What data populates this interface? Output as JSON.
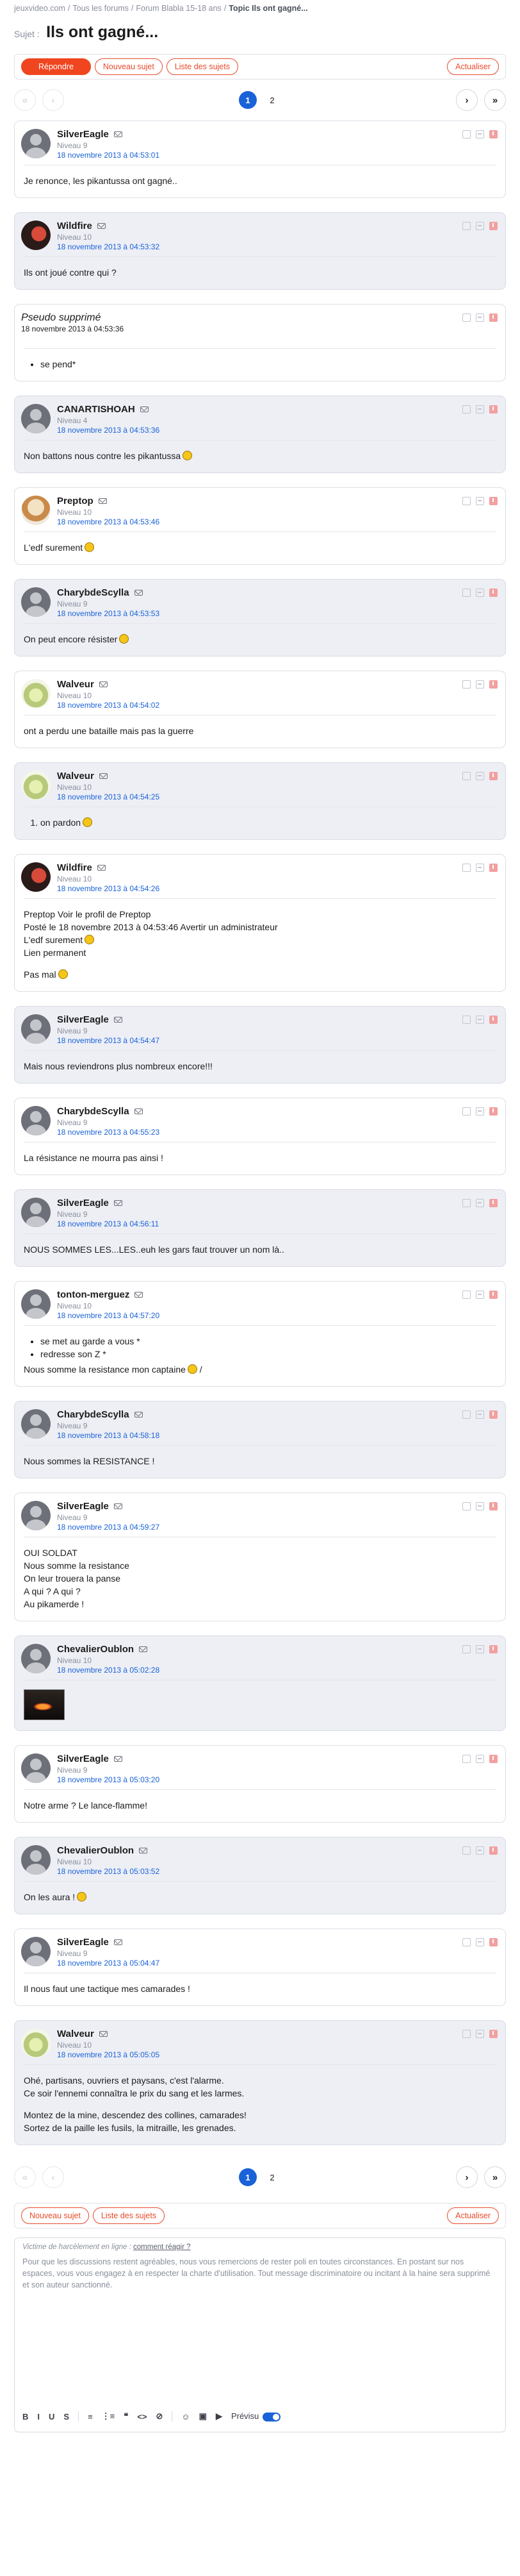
{
  "breadcrumb": [
    "jeuxvideo.com",
    "Tous les forums",
    "Forum Blabla 15-18 ans",
    "Topic Ils ont gagné..."
  ],
  "subject": {
    "label": "Sujet :",
    "title": "Ils ont gagné..."
  },
  "toolbar": {
    "reply": "Répondre",
    "new_topic": "Nouveau sujet",
    "list": "Liste des sujets",
    "refresh": "Actualiser"
  },
  "pagination": {
    "pages": [
      "1",
      "2"
    ],
    "current": "1",
    "first": "«",
    "prev": "‹",
    "next": "›",
    "last": "»"
  },
  "posts": [
    {
      "author": "SilverEagle",
      "level": "Niveau 9",
      "date": "18 novembre 2013 à 04:53:01",
      "avatar": "default",
      "lines": [
        "Je renonce, les pikantussa ont gagné.."
      ]
    },
    {
      "author": "Wildfire",
      "level": "Niveau 10",
      "date": "18 novembre 2013 à 04:53:32",
      "avatar": "wildfire",
      "lines": [
        "Ils ont joué contre qui ?"
      ]
    },
    {
      "author": "Pseudo supprimé",
      "level": "",
      "date": "18 novembre 2013 à 04:53:36",
      "avatar": "none",
      "bullets": [
        "se pend*"
      ]
    },
    {
      "author": "CANARTISHOAH",
      "level": "Niveau 4",
      "date": "18 novembre 2013 à 04:53:36",
      "avatar": "default",
      "lines": [
        "Non battons nous contre les pikantussa"
      ],
      "smiley": true
    },
    {
      "author": "Preptop",
      "level": "Niveau 10",
      "date": "18 novembre 2013 à 04:53:46",
      "avatar": "preptop",
      "lines": [
        "L'edf surement"
      ],
      "smiley": true
    },
    {
      "author": "CharybdeScylla",
      "level": "Niveau 9",
      "date": "18 novembre 2013 à 04:53:53",
      "avatar": "default",
      "lines": [
        "On peut encore résister"
      ],
      "smiley": true
    },
    {
      "author": "Walveur",
      "level": "Niveau 10",
      "date": "18 novembre 2013 à 04:54:02",
      "avatar": "walveur",
      "lines": [
        "ont a perdu une bataille mais pas la guerre"
      ]
    },
    {
      "author": "Walveur",
      "level": "Niveau 10",
      "date": "18 novembre 2013 à 04:54:25",
      "avatar": "walveur",
      "ordered": [
        "on pardon"
      ],
      "smiley": true
    },
    {
      "author": "Wildfire",
      "level": "Niveau 10",
      "date": "18 novembre 2013 à 04:54:26",
      "avatar": "wildfire",
      "lines": [
        "Preptop Voir le profil de Preptop",
        "Posté le 18 novembre 2013 à 04:53:46 Avertir un administrateur",
        "L'edf surement",
        "Lien permanent",
        "",
        "Pas mal"
      ]
    },
    {
      "author": "SilverEagle",
      "level": "Niveau 9",
      "date": "18 novembre 2013 à 04:54:47",
      "avatar": "default",
      "lines": [
        "Mais nous reviendrons plus nombreux encore!!!"
      ]
    },
    {
      "author": "CharybdeScylla",
      "level": "Niveau 9",
      "date": "18 novembre 2013 à 04:55:23",
      "avatar": "default",
      "lines": [
        "La résistance ne mourra pas ainsi !"
      ]
    },
    {
      "author": "SilverEagle",
      "level": "Niveau 9",
      "date": "18 novembre 2013 à 04:56:11",
      "avatar": "default",
      "lines": [
        "NOUS SOMMES LES...LES..euh les gars faut trouver un nom là.."
      ]
    },
    {
      "author": "tonton-merguez",
      "level": "Niveau 10",
      "date": "18 novembre 2013 à 04:57:20",
      "avatar": "default",
      "bullets": [
        "se met au garde a vous *",
        "redresse son Z *"
      ],
      "lines": [
        "Nous somme la resistance mon captaine",
        "/"
      ]
    },
    {
      "author": "CharybdeScylla",
      "level": "Niveau 9",
      "date": "18 novembre 2013 à 04:58:18",
      "avatar": "default",
      "lines": [
        "Nous sommes la RESISTANCE !"
      ]
    },
    {
      "author": "SilverEagle",
      "level": "Niveau 9",
      "date": "18 novembre 2013 à 04:59:27",
      "avatar": "default",
      "lines": [
        "OUI SOLDAT",
        "Nous somme la resistance",
        "On leur trouera la panse",
        "A qui ? A qui ?",
        "Au pikamerde !"
      ]
    },
    {
      "author": "ChevalierOublon",
      "level": "Niveau 10",
      "date": "18 novembre 2013 à 05:02:28",
      "avatar": "default",
      "image": true
    },
    {
      "author": "SilverEagle",
      "level": "Niveau 9",
      "date": "18 novembre 2013 à 05:03:20",
      "avatar": "default",
      "lines": [
        "Notre arme ? Le lance-flamme!"
      ]
    },
    {
      "author": "ChevalierOublon",
      "level": "Niveau 10",
      "date": "18 novembre 2013 à 05:03:52",
      "avatar": "default",
      "lines": [
        "On les aura !"
      ],
      "smiley": true
    },
    {
      "author": "SilverEagle",
      "level": "Niveau 9",
      "date": "18 novembre 2013 à 05:04:47",
      "avatar": "default",
      "lines": [
        "Il nous faut une tactique mes camarades !"
      ]
    },
    {
      "author": "Walveur",
      "level": "Niveau 10",
      "date": "18 novembre 2013 à 05:05:05",
      "avatar": "walveur",
      "lines": [
        "Ohé, partisans, ouvriers et paysans, c'est l'alarme.",
        "Ce soir l'ennemi connaîtra le prix du sang et les larmes.",
        "",
        "Montez de la mine, descendez des collines, camarades!",
        "Sortez de la paille les fusils, la mitraille, les grenades."
      ]
    }
  ],
  "editor": {
    "harass": "Victime de harcèlement en ligne :",
    "harass_link": "comment réagir ?",
    "note": "Pour que les discussions restent agréables, nous vous remercions de rester poli en toutes circonstances. En postant sur nos espaces, vous vous engagez à en respecter la charte d'utilisation. Tout message discriminatoire ou incitant à la haine sera supprimé et son auteur sanctionné.",
    "tools": [
      "B",
      "I",
      "U",
      "S",
      "≡",
      "⋮≡",
      "❝",
      "<>",
      "⊘",
      "☺",
      "▣",
      "▶"
    ],
    "preview": "Prévisu"
  }
}
